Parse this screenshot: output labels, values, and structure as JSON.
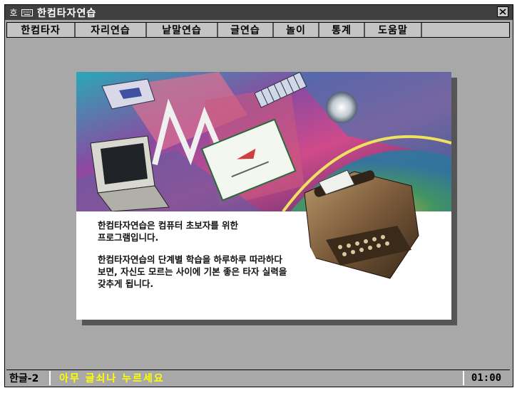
{
  "window": {
    "title": "한컴타자연습",
    "system_icon": "ho-icon",
    "keyboard_icon": "keyboard-icon"
  },
  "menu": {
    "items": [
      {
        "label": "한컴타자"
      },
      {
        "label": "자리연습"
      },
      {
        "label": "낱말연습"
      },
      {
        "label": "글연습"
      },
      {
        "label": "놀이"
      },
      {
        "label": "통계"
      },
      {
        "label": "도움말"
      }
    ]
  },
  "intro": {
    "paragraph1": "한컴타자연습은 컴퓨터 초보자를 위한\n프로그램입니다.",
    "paragraph2": "한컴타자연습의 단계별 학습을 하루하루 따라하다\n보면, 자신도 모르는 사이에 기본 좋은 타자 실력을\n갖추게 됩니다."
  },
  "status": {
    "input_mode": "한글-2",
    "message": "아무 글쇠나 누르세요",
    "clock": "01:00"
  },
  "colors": {
    "background": "#a8a8a8",
    "titlebar": "#404040",
    "status_message": "#ffff00"
  }
}
